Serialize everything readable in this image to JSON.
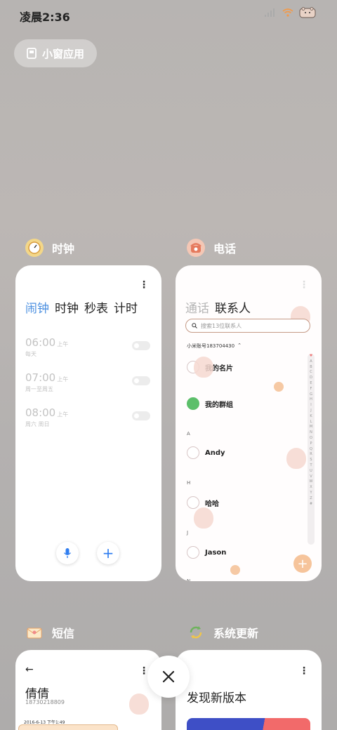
{
  "status": {
    "time": "凌晨2:36"
  },
  "pill": {
    "label": "小窗应用"
  },
  "clock": {
    "app_name": "时钟",
    "tabs": [
      "闹钟",
      "时钟",
      "秒表",
      "计时"
    ],
    "alarms": [
      {
        "time": "06:00",
        "ampm": "上午",
        "repeat": "每天"
      },
      {
        "time": "07:00",
        "ampm": "上午",
        "repeat": "周一至周五"
      },
      {
        "time": "08:00",
        "ampm": "上午",
        "repeat": "周六 周日"
      }
    ]
  },
  "phone": {
    "app_name": "电话",
    "tabs": [
      "通话",
      "联系人"
    ],
    "search_placeholder": "搜索13位联系人",
    "account": "小米账号183704430",
    "my_card": "我的名片",
    "my_group": "我的群组",
    "sections": [
      {
        "letter": "A",
        "name": "Andy"
      },
      {
        "letter": "H",
        "name": "哈哈"
      },
      {
        "letter": "J",
        "name": "Jason"
      }
    ],
    "next_letter": "N",
    "az": [
      "♥",
      "A",
      "B",
      "C",
      "D",
      "E",
      "F",
      "G",
      "H",
      "I",
      "J",
      "K",
      "L",
      "M",
      "N",
      "O",
      "P",
      "Q",
      "R",
      "S",
      "T",
      "U",
      "V",
      "W",
      "X",
      "Y",
      "Z",
      "#"
    ]
  },
  "sms": {
    "app_name": "短信",
    "contact": "倩倩",
    "number": "18730218809",
    "date": "2016-6-13 下午1:49"
  },
  "update": {
    "app_name": "系统更新",
    "title": "发现新版本"
  },
  "colors": {
    "accent_blue": "#2f7df0",
    "tab_active_blue": "#4a8fe0",
    "group_green": "#5cbf6a",
    "fab_peach": "#f6c49b"
  }
}
